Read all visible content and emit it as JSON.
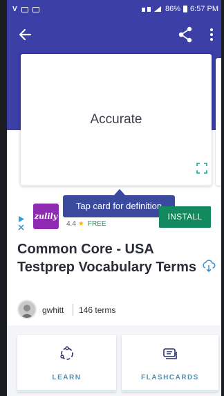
{
  "status_bar": {
    "left_glyph": "V",
    "battery_text": "86%",
    "time": "6:57 PM"
  },
  "app_bar": {
    "back_icon": "arrow-back-icon",
    "share_icon": "share-icon",
    "more_icon": "more-vert-icon",
    "color": "#3b3fa6"
  },
  "card": {
    "term": "Accurate",
    "expand_icon": "fullscreen-icon"
  },
  "tooltip": {
    "text": "Tap card for definition"
  },
  "ad": {
    "brand_logo_text": "zulily",
    "rating": "4.4",
    "price": "FREE",
    "install_label": "INSTALL",
    "install_color": "#13895f",
    "ad_choices_icon": "ad-choices-icon"
  },
  "set": {
    "title": "Common Core - USA Testprep Vocabulary Terms",
    "download_icon": "cloud-download-icon",
    "author": "gwhitt",
    "term_count": "146 terms"
  },
  "study_modes": [
    {
      "label": "LEARN",
      "icon": "learn-cycle-icon"
    },
    {
      "label": "FLASHCARDS",
      "icon": "flashcards-icon"
    }
  ],
  "colors": {
    "accent": "#3b3fa6",
    "mode_label": "#4a8fb6",
    "tooltip": "#3b4a9c"
  }
}
